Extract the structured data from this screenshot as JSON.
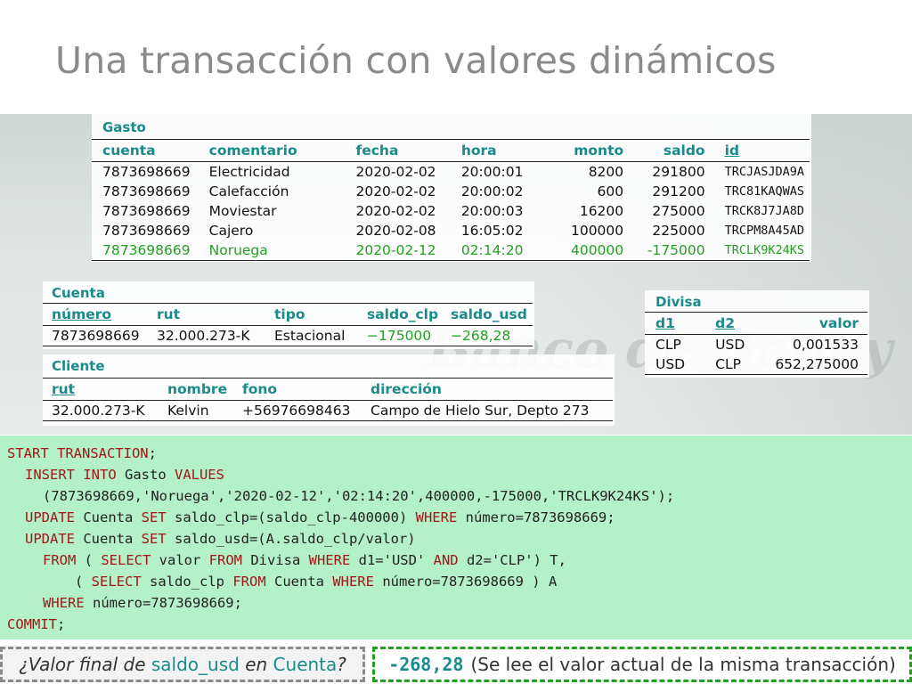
{
  "title": "Una transacción con valores dinámicos",
  "gasto": {
    "caption": "Gasto",
    "headers": [
      "cuenta",
      "comentario",
      "fecha",
      "hora",
      "monto",
      "saldo",
      "id"
    ],
    "rows": [
      [
        "7873698669",
        "Electricidad",
        "2020-02-02",
        "20:00:01",
        "8200",
        "291800",
        "TRCJASJDA9A"
      ],
      [
        "7873698669",
        "Calefacción",
        "2020-02-02",
        "20:00:02",
        "600",
        "291200",
        "TRC81KAQWAS"
      ],
      [
        "7873698669",
        "Moviestar",
        "2020-02-02",
        "20:00:03",
        "16200",
        "275000",
        "TRCK8J7JA8D"
      ],
      [
        "7873698669",
        "Cajero",
        "2020-02-08",
        "16:05:02",
        "100000",
        "225000",
        "TRCPM8A45AD"
      ],
      [
        "7873698669",
        "Noruega",
        "2020-02-12",
        "02:14:20",
        "400000",
        "-175000",
        "TRCLK9K24KS"
      ]
    ]
  },
  "cuenta": {
    "caption": "Cuenta",
    "headers": [
      "número",
      "rut",
      "tipo",
      "saldo_clp",
      "saldo_usd"
    ],
    "row": [
      "7873698669",
      "32.000.273-K",
      "Estacional",
      "−175000",
      "−268,28"
    ]
  },
  "cliente": {
    "caption": "Cliente",
    "headers": [
      "rut",
      "nombre",
      "fono",
      "dirección"
    ],
    "row": [
      "32.000.273-K",
      "Kelvin",
      "+56976698463",
      "Campo de Hielo Sur, Depto 273"
    ]
  },
  "divisa": {
    "caption": "Divisa",
    "headers": [
      "d1",
      "d2",
      "valor"
    ],
    "rows": [
      [
        "CLP",
        "USD",
        "0,001533"
      ],
      [
        "USD",
        "CLP",
        "652,275000"
      ]
    ]
  },
  "watermark": "Banco de Bailey",
  "code": {
    "l1": {
      "kw1": "START TRANSACTION",
      "t1": ";"
    },
    "l2": {
      "kw1": "INSERT INTO",
      "t1": " Gasto ",
      "kw2": "VALUES"
    },
    "l3": {
      "t1": "(7873698669,'Noruega','2020-02-12','02:14:20',400000,-175000,'TRCLK9K24KS');"
    },
    "l4": {
      "kw1": "UPDATE",
      "t1": " Cuenta ",
      "kw2": "SET",
      "t2": " saldo_clp=(saldo_clp-400000) ",
      "kw3": "WHERE",
      "t3": " número=7873698669;"
    },
    "l5": {
      "kw1": "UPDATE",
      "t1": " Cuenta ",
      "kw2": "SET",
      "t2": " saldo_usd=(A.saldo_clp/valor)"
    },
    "l6": {
      "kw1": "FROM",
      "t1": " ( ",
      "kw2": "SELECT",
      "t2": " valor ",
      "kw3": "FROM",
      "t3": " Divisa ",
      "kw4": "WHERE",
      "t4": " d1='USD' ",
      "kw5": "AND",
      "t5": " d2='CLP') T,"
    },
    "l7": {
      "t0": "( ",
      "kw1": "SELECT",
      "t1": " saldo_clp ",
      "kw2": "FROM",
      "t2": " Cuenta ",
      "kw3": "WHERE",
      "t3": " número=7873698669 ) A"
    },
    "l8": {
      "kw1": "WHERE",
      "t1": " número=7873698669;"
    },
    "l9": {
      "kw1": "COMMIT",
      "t1": ";"
    }
  },
  "question": {
    "p1": "¿Valor final de ",
    "p2": "saldo_usd",
    "p3": " en ",
    "p4": "Cuenta",
    "p5": "?"
  },
  "answer": {
    "value": "-268,28",
    "text": "(Se lee el valor actual de la misma transacción)"
  },
  "colors": {
    "teal": "#1a8a8a",
    "green": "#22a022",
    "keyword": "#a01818",
    "code_bg": "#b4f0c8"
  }
}
